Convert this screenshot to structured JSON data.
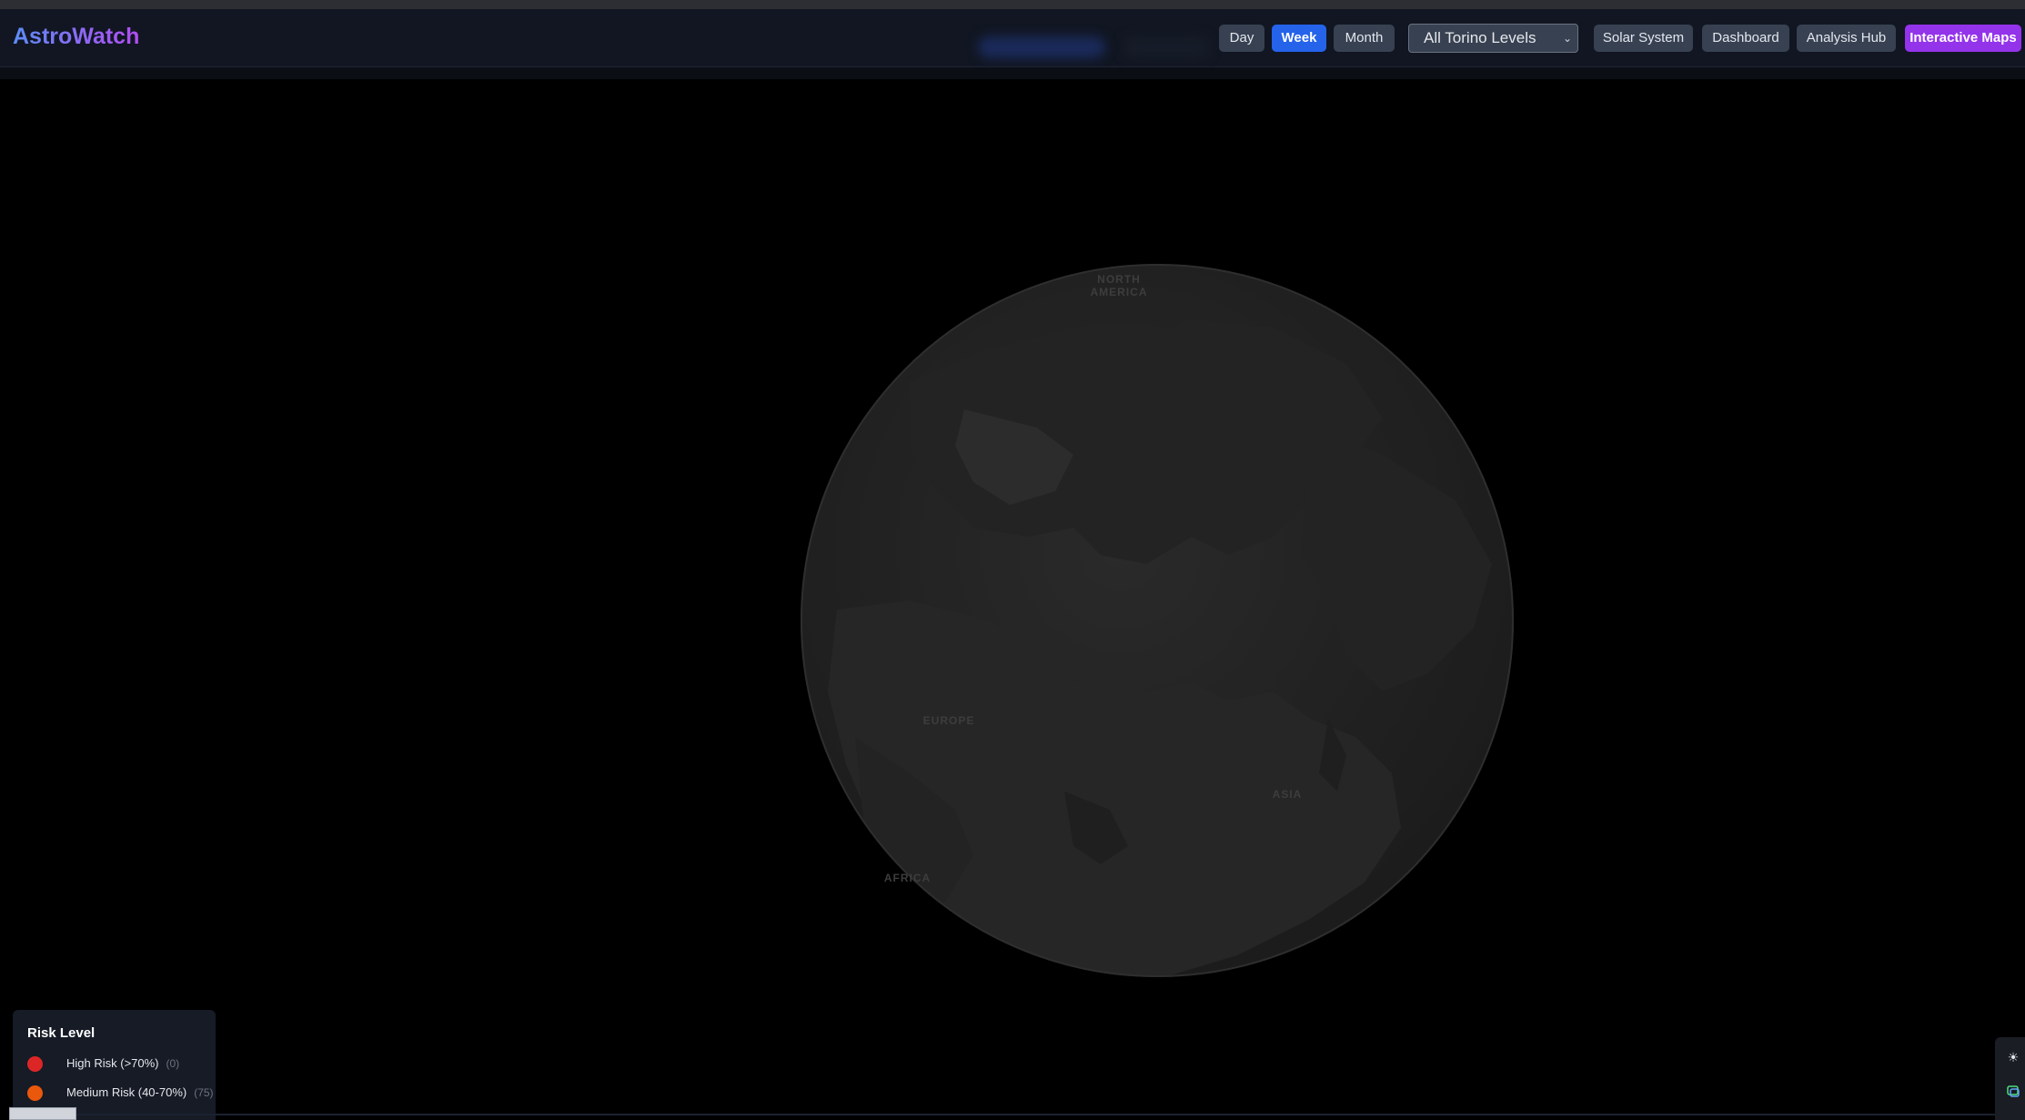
{
  "app": {
    "title": "AstroWatch"
  },
  "time_range": {
    "buttons": [
      {
        "label": "Day",
        "active": false
      },
      {
        "label": "Week",
        "active": true
      },
      {
        "label": "Month",
        "active": false
      }
    ]
  },
  "filter": {
    "selected": "All Torino Levels"
  },
  "nav": {
    "items": [
      {
        "label": "Solar System",
        "active": false
      },
      {
        "label": "Dashboard",
        "active": false
      },
      {
        "label": "Analysis Hub",
        "active": false
      },
      {
        "label": "Interactive Maps",
        "active": true
      }
    ]
  },
  "globe": {
    "labels": {
      "north_america": "NORTH AMERICA",
      "europe": "EUROPE",
      "asia": "ASIA",
      "africa": "AFRICA"
    }
  },
  "legend": {
    "title": "Risk Level",
    "items": [
      {
        "label": "High Risk (>70%)",
        "count": "(0)",
        "color": "#dc2626"
      },
      {
        "label": "Medium Risk (40-70%)",
        "count": "(75)",
        "color": "#ea580c"
      }
    ]
  },
  "map_controls": {
    "sun_icon": "sun-icon",
    "layers_icon": "layers-icon"
  },
  "colors": {
    "background": "#000000",
    "navbar": "#111622",
    "active_button": "#2563eb",
    "maps_button": "#9333ea"
  }
}
